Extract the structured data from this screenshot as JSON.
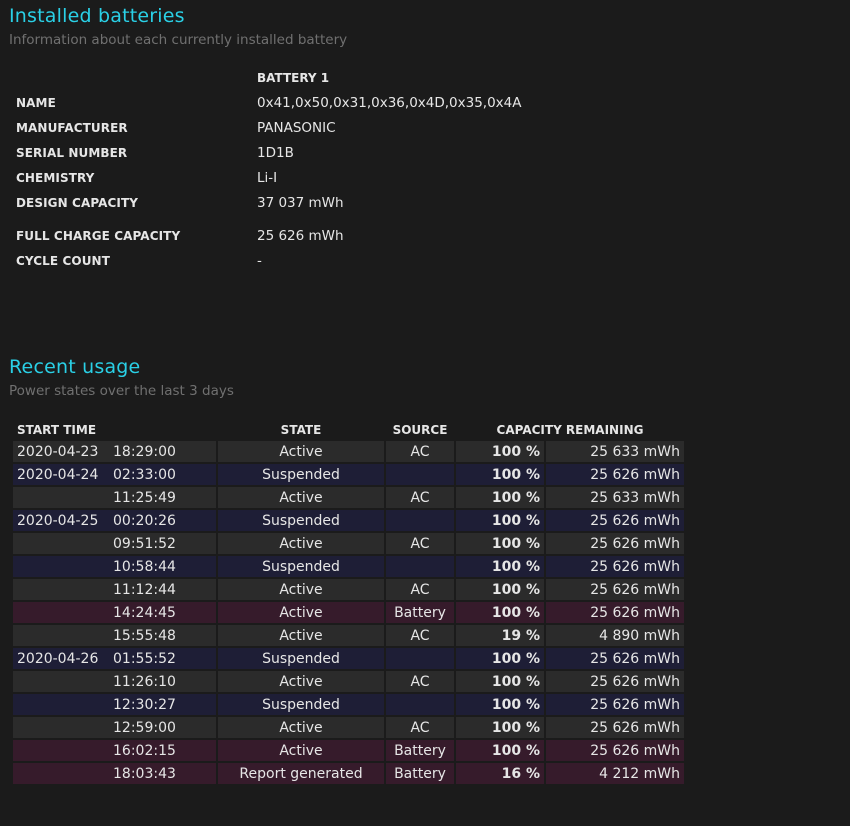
{
  "installed": {
    "title": "Installed batteries",
    "subtitle": "Information about each currently installed battery",
    "battery_header": "BATTERY 1",
    "rows": [
      {
        "key": "NAME",
        "value": "0x41,0x50,0x31,0x36,0x4D,0x35,0x4A"
      },
      {
        "key": "MANUFACTURER",
        "value": "PANASONIC"
      },
      {
        "key": "SERIAL NUMBER",
        "value": "1D1B"
      },
      {
        "key": "CHEMISTRY",
        "value": "Li-I"
      },
      {
        "key": "DESIGN CAPACITY",
        "value": "37 037 mWh"
      },
      {
        "key": "FULL CHARGE CAPACITY",
        "value": "25 626 mWh"
      },
      {
        "key": "CYCLE COUNT",
        "value": "-"
      }
    ]
  },
  "recent": {
    "title": "Recent usage",
    "subtitle": "Power states over the last 3 days",
    "columns": {
      "start_time": "START TIME",
      "state": "STATE",
      "source": "SOURCE",
      "capacity": "CAPACITY REMAINING"
    },
    "rows": [
      {
        "date": "2020-04-23",
        "time": "18:29:00",
        "state": "Active",
        "source": "AC",
        "pct": "100 %",
        "cap": "25 633 mWh",
        "kind": "ac"
      },
      {
        "date": "2020-04-24",
        "time": "02:33:00",
        "state": "Suspended",
        "source": "",
        "pct": "100 %",
        "cap": "25 626 mWh",
        "kind": "sus"
      },
      {
        "date": "",
        "time": "11:25:49",
        "state": "Active",
        "source": "AC",
        "pct": "100 %",
        "cap": "25 633 mWh",
        "kind": "ac"
      },
      {
        "date": "2020-04-25",
        "time": "00:20:26",
        "state": "Suspended",
        "source": "",
        "pct": "100 %",
        "cap": "25 626 mWh",
        "kind": "sus"
      },
      {
        "date": "",
        "time": "09:51:52",
        "state": "Active",
        "source": "AC",
        "pct": "100 %",
        "cap": "25 626 mWh",
        "kind": "ac"
      },
      {
        "date": "",
        "time": "10:58:44",
        "state": "Suspended",
        "source": "",
        "pct": "100 %",
        "cap": "25 626 mWh",
        "kind": "sus"
      },
      {
        "date": "",
        "time": "11:12:44",
        "state": "Active",
        "source": "AC",
        "pct": "100 %",
        "cap": "25 626 mWh",
        "kind": "ac"
      },
      {
        "date": "",
        "time": "14:24:45",
        "state": "Active",
        "source": "Battery",
        "pct": "100 %",
        "cap": "25 626 mWh",
        "kind": "bat"
      },
      {
        "date": "",
        "time": "15:55:48",
        "state": "Active",
        "source": "AC",
        "pct": "19 %",
        "cap": "4 890 mWh",
        "kind": "ac"
      },
      {
        "date": "2020-04-26",
        "time": "01:55:52",
        "state": "Suspended",
        "source": "",
        "pct": "100 %",
        "cap": "25 626 mWh",
        "kind": "sus"
      },
      {
        "date": "",
        "time": "11:26:10",
        "state": "Active",
        "source": "AC",
        "pct": "100 %",
        "cap": "25 626 mWh",
        "kind": "ac"
      },
      {
        "date": "",
        "time": "12:30:27",
        "state": "Suspended",
        "source": "",
        "pct": "100 %",
        "cap": "25 626 mWh",
        "kind": "sus"
      },
      {
        "date": "",
        "time": "12:59:00",
        "state": "Active",
        "source": "AC",
        "pct": "100 %",
        "cap": "25 626 mWh",
        "kind": "ac"
      },
      {
        "date": "",
        "time": "16:02:15",
        "state": "Active",
        "source": "Battery",
        "pct": "100 %",
        "cap": "25 626 mWh",
        "kind": "bat"
      },
      {
        "date": "",
        "time": "18:03:43",
        "state": "Report generated",
        "source": "Battery",
        "pct": "16 %",
        "cap": "4 212 mWh",
        "kind": "bat"
      }
    ]
  },
  "colors": {
    "heading": "#2ad0e6",
    "row_ac": "#2b2b2b",
    "row_suspended": "#1e1e36",
    "row_battery": "#361b2b"
  }
}
